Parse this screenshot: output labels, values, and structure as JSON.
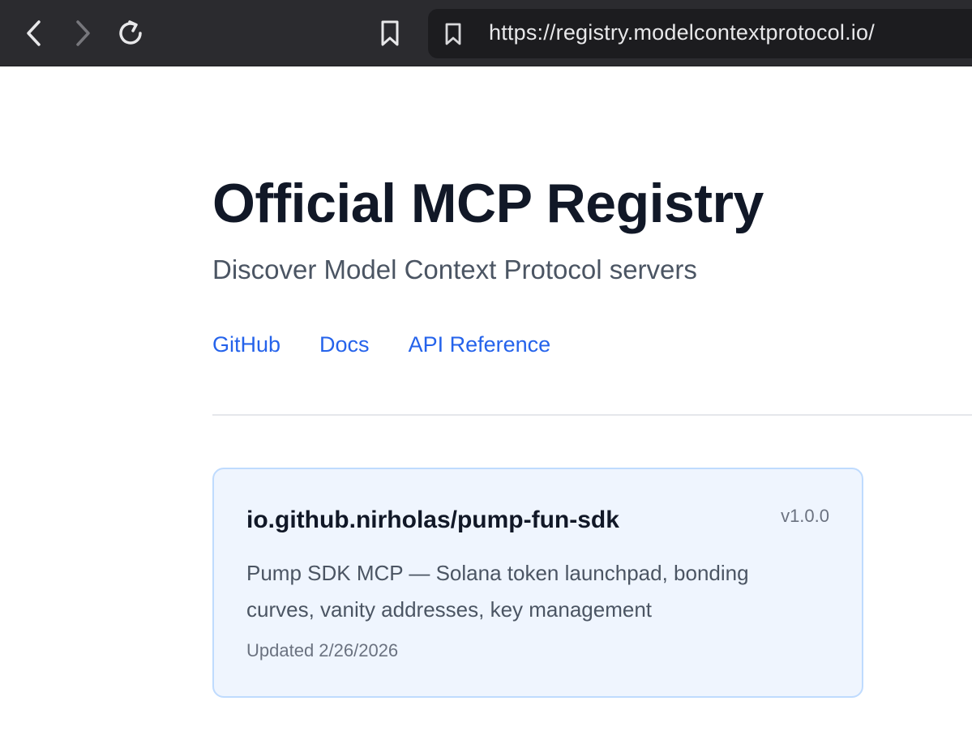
{
  "browser": {
    "url": "https://registry.modelcontextprotocol.io/",
    "icons": {
      "back": "chevron-left-icon",
      "forward": "chevron-right-icon",
      "reload": "reload-icon",
      "bookmark": "bookmark-icon"
    }
  },
  "header": {
    "title": "Official MCP Registry",
    "subtitle": "Discover Model Context Protocol servers"
  },
  "nav": {
    "links": [
      {
        "label": "GitHub"
      },
      {
        "label": "Docs"
      },
      {
        "label": "API Reference"
      }
    ]
  },
  "servers": [
    {
      "name": "io.github.nirholas/pump-fun-sdk",
      "version": "v1.0.0",
      "description": "Pump SDK MCP — Solana token launchpad, bonding curves, vanity addresses, key management",
      "updated": "Updated 2/26/2026"
    }
  ],
  "colors": {
    "browser_bar": "#2b2b2f",
    "link": "#2563eb",
    "card_background": "#eff5fe",
    "card_border": "#bfdbfe",
    "title": "#111827"
  }
}
